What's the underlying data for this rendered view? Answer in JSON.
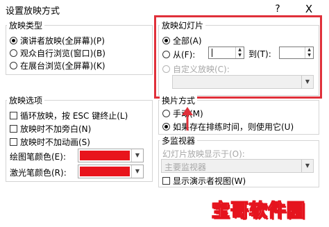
{
  "window": {
    "title": "设置放映方式",
    "help_label": "?",
    "close_label": "X"
  },
  "show_type": {
    "legend": "放映类型",
    "options": [
      {
        "label": "演讲者放映(全屏幕)(P)",
        "selected": true
      },
      {
        "label": "观众自行浏览(窗口)(B)",
        "selected": false
      },
      {
        "label": "在展台浏览(全屏幕)(K)",
        "selected": false
      }
    ]
  },
  "show_slides": {
    "legend": "放映幻灯片",
    "all_label": "全部(A)",
    "from_label": "从(F):",
    "to_label": "到(T):",
    "custom_label": "自定义放映(C):",
    "from_value": "",
    "to_value": ""
  },
  "show_options": {
    "legend": "放映选项",
    "items": [
      {
        "label": "循环放映，按 ESC 键终止(L)",
        "checked": false
      },
      {
        "label": "放映时不加旁白(N)",
        "checked": false
      },
      {
        "label": "放映时不加动画(S)",
        "checked": false
      }
    ],
    "pen_color_label": "绘图笔颜色(E):",
    "laser_color_label": "激光笔颜色(R):",
    "pen_color": "#e8141c",
    "laser_color": "#e8141c"
  },
  "advance": {
    "legend": "换片方式",
    "options": [
      {
        "label": "手动(M)",
        "selected": false
      },
      {
        "label": "如果存在排练时间，则使用它(U)",
        "selected": true
      }
    ]
  },
  "monitors": {
    "legend": "多监视器",
    "display_label": "幻灯片放映显示于(O):",
    "display_value": "主要监视器",
    "presenter_view_label": "显示演示者视图(W)",
    "presenter_view_checked": false
  },
  "watermark": {
    "text": "宝哥软件园"
  },
  "colors": {
    "highlight": "#e0303a",
    "swatch_red": "#e8141c"
  }
}
